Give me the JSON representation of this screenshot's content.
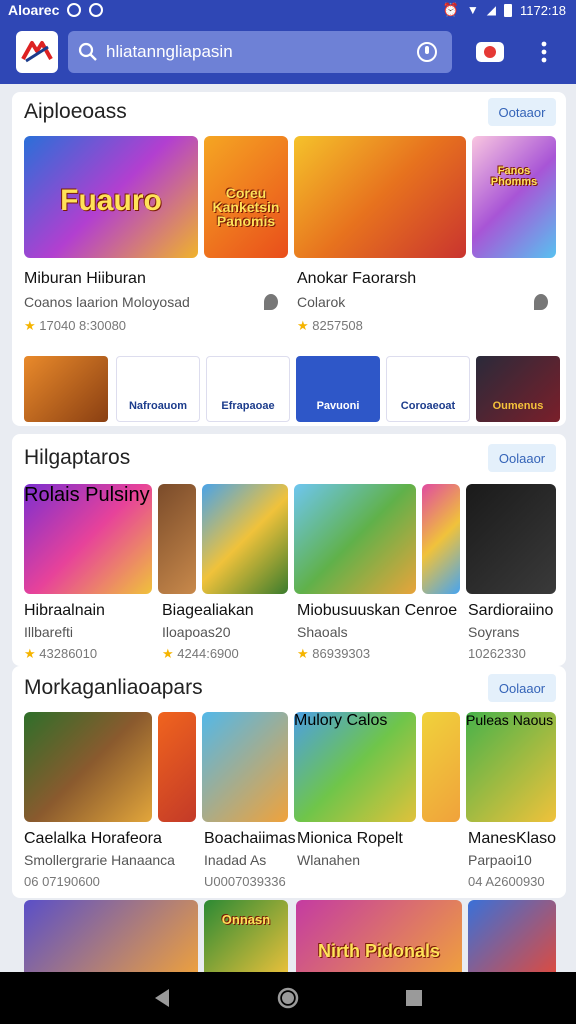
{
  "status_bar": {
    "carrier": "Aloarec",
    "time": "1172:18"
  },
  "app_bar": {
    "search_text": "hliatanngliapasin"
  },
  "sections": [
    {
      "title": "Aiploeoass",
      "more_label": "Ootaaor",
      "items": [
        {
          "name": "Miburan Hiiburan",
          "subtitle": "Coanos laarion Moloyosad",
          "rating": "17040  8:30080"
        },
        {
          "name": "Anokar Faorarsh",
          "subtitle": "Colarok",
          "rating": "8257508"
        }
      ],
      "banner_texts": [
        "Fuauro",
        "Coreu Kanketsin Panomis",
        "",
        "Fanos Phomms"
      ],
      "small_tiles": [
        "",
        "Nafroauom",
        "Efrapaoae",
        "Pavuoni",
        "Coroaeoat",
        "Oumenus"
      ]
    },
    {
      "title": "Hilgaptaros",
      "more_label": "Oolaaor",
      "tile_texts": [
        "Rolais Pulsiny",
        "",
        "",
        "",
        "",
        ""
      ],
      "items": [
        {
          "name": "Hibraalnain",
          "subtitle": "Illbarefti",
          "rating": "43286010"
        },
        {
          "name": "Biagealiakan",
          "subtitle": "Iloapoas20",
          "rating": "4244:6900"
        },
        {
          "name": "Miobusuuskan Cenroe",
          "subtitle": "Shaoals",
          "rating": "86939303"
        },
        {
          "name": "Sardioraiino",
          "subtitle": "Soyrans",
          "rating": "10262330"
        }
      ]
    },
    {
      "title": "Morkaganliaoapars",
      "more_label": "Oolaaor",
      "tile_texts": [
        "",
        "",
        "",
        "Mulory Calos",
        "",
        "Puleas Naous"
      ],
      "items": [
        {
          "name": "Caelalka Horafeora",
          "subtitle": "Smollergrarie Hanaanca",
          "rating": "06 07190600"
        },
        {
          "name": "Boachaiimas",
          "subtitle": "Inadad As",
          "rating": "U0007039336"
        },
        {
          "name": "Mionica Ropelt",
          "subtitle": "Wlanahen",
          "rating": ""
        },
        {
          "name": "ManesKlaso",
          "subtitle": "Parpaoi10",
          "rating": "04 A2600930"
        }
      ]
    }
  ],
  "fourth_row_texts": [
    "",
    "",
    "Onnasn",
    "Nirth Pidonals",
    ""
  ],
  "colors": {
    "primary": "#2f47b5",
    "accent_button_bg": "#e4f0fb",
    "star": "#f5b400"
  }
}
